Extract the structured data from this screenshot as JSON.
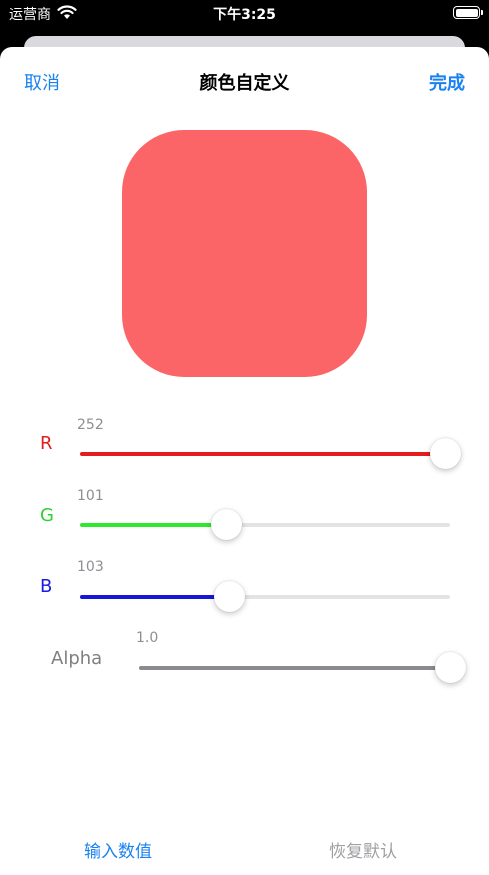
{
  "status_bar": {
    "carrier": "运营商",
    "time": "下午3:25",
    "battery_level": 1.0
  },
  "nav": {
    "cancel_label": "取消",
    "title": "颜色自定义",
    "done_label": "完成"
  },
  "preview": {
    "color": "#FC6567"
  },
  "sliders": [
    {
      "label": "R",
      "value_text": "252",
      "value": 252,
      "max": 255,
      "label_color": "#e31c1c",
      "fill_color": "#e31c1c"
    },
    {
      "label": "G",
      "value_text": "101",
      "value": 101,
      "max": 255,
      "label_color": "#2ed12e",
      "fill_color": "#2ee82e"
    },
    {
      "label": "B",
      "value_text": "103",
      "value": 103,
      "max": 255,
      "label_color": "#1a1ae0",
      "fill_color": "#1616d6"
    },
    {
      "label": "Alpha",
      "value_text": "1.0",
      "value": 1.0,
      "max": 1.0,
      "label_color": "#808080",
      "fill_color": "#8a8a8f"
    }
  ],
  "bottom": {
    "input_label": "输入数值",
    "reset_label": "恢复默认"
  },
  "colors": {
    "accent": "#1a82f0",
    "disabled": "#a0a0a4"
  }
}
